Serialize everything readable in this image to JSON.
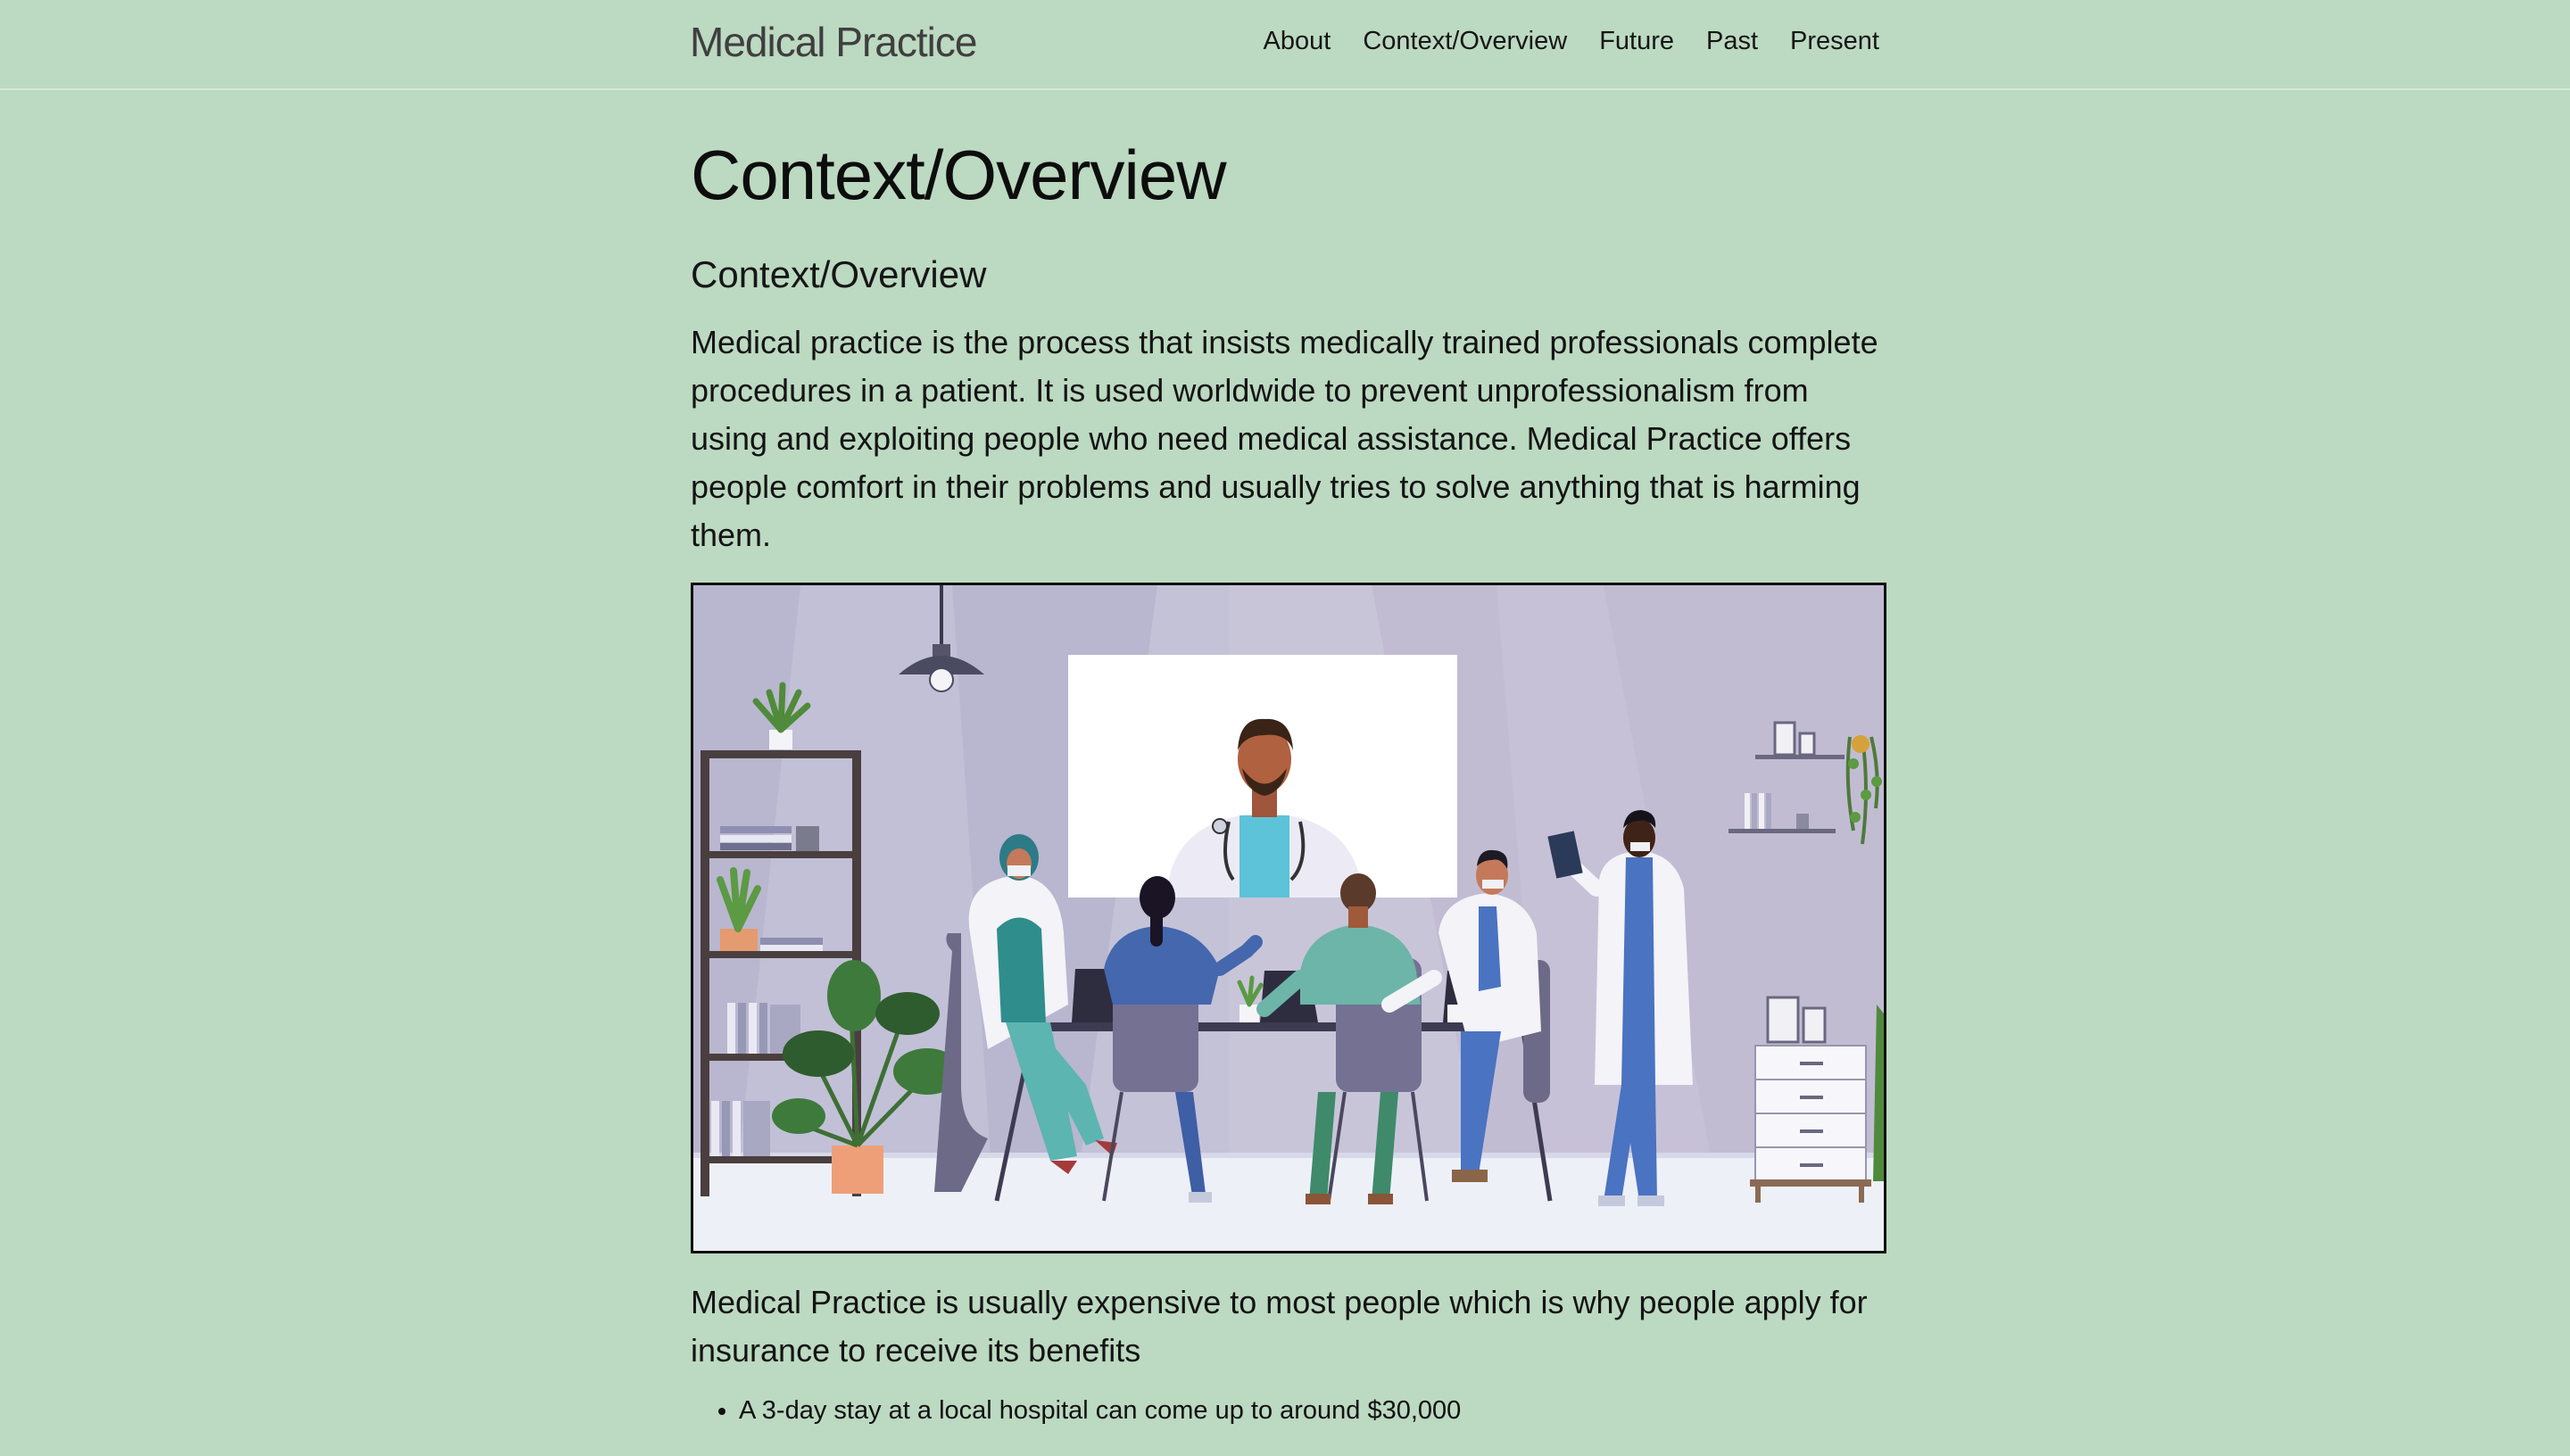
{
  "header": {
    "site_title": "Medical Practice",
    "nav": [
      {
        "label": "About"
      },
      {
        "label": "Context/Overview"
      },
      {
        "label": "Future"
      },
      {
        "label": "Past"
      },
      {
        "label": "Present"
      }
    ]
  },
  "main": {
    "page_title": "Context/Overview",
    "section_heading": "Context/Overview",
    "intro_paragraph": "Medical practice is the process that insists medically trained professionals complete procedures in a patient. It is used worldwide to prevent unprofessionalism from using and exploiting people who need medical assistance. Medical Practice offers people comfort in their problems and usually tries to solve anything that is harming them.",
    "second_paragraph": "Medical Practice is usually expensive to most people which is why people apply for insurance to receive its benefits",
    "facts": [
      "A 3-day stay at a local hospital can come up to around $30,000"
    ]
  },
  "colors": {
    "page_background": "#bcd9c1",
    "header_border": "#d7e9da",
    "text": "#111111",
    "illustration_wall": "#c3c0d6"
  }
}
